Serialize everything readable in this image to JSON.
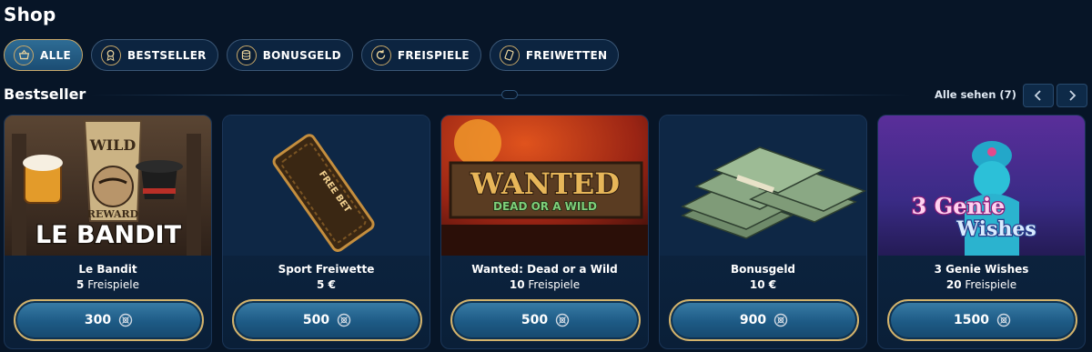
{
  "page": {
    "title": "Shop"
  },
  "filters": [
    {
      "label": "ALLE",
      "icon": "basket-icon",
      "active": true
    },
    {
      "label": "BESTSELLER",
      "icon": "medal-icon",
      "active": false
    },
    {
      "label": "BONUSGELD",
      "icon": "coins-icon",
      "active": false
    },
    {
      "label": "FREISPIELE",
      "icon": "spin-icon",
      "active": false
    },
    {
      "label": "FREIWETTEN",
      "icon": "ticket-icon",
      "active": false
    }
  ],
  "section": {
    "title": "Bestseller",
    "see_all": "Alle sehen (7)"
  },
  "cards": [
    {
      "title": "Le Bandit",
      "amount": "5",
      "unit": "Freispiele",
      "price": "300",
      "art_text_1": "WILD",
      "art_text_2": "REWARD",
      "art_text_3": "LE BANDIT"
    },
    {
      "title": "Sport Freiwette",
      "amount": "5 €",
      "unit": "",
      "price": "500",
      "art_text_1": "FREE BET"
    },
    {
      "title": "Wanted: Dead or a Wild",
      "amount": "10",
      "unit": "Freispiele",
      "price": "500",
      "art_text_1": "WANTED",
      "art_text_2": "DEAD OR A WILD"
    },
    {
      "title": "Bonusgeld",
      "amount": "10 €",
      "unit": "",
      "price": "900"
    },
    {
      "title": "3 Genie Wishes",
      "amount": "20",
      "unit": "Freispiele",
      "price": "1500",
      "art_text_1": "3 Genie",
      "art_text_2": "Wishes"
    }
  ],
  "colors": {
    "background": "#071527",
    "accent_gold": "#d4b36b",
    "button_blue": "#1d5a85"
  }
}
